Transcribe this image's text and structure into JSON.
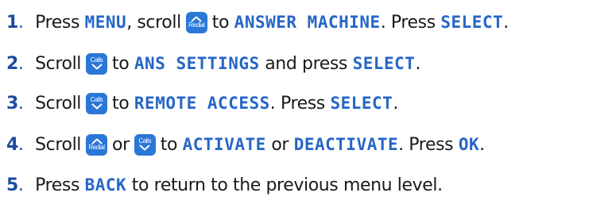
{
  "steps": [
    {
      "number": "1",
      "period": ".",
      "t1": " Press ",
      "lcd1": "MENU",
      "t2": ", scroll",
      "key1": {
        "label": "Redial",
        "icon": "chevron-up-icon"
      },
      "t3": "to ",
      "lcd2": "ANSWER MACHINE",
      "t4": ". Press ",
      "lcd3": "SELECT",
      "t5": "."
    },
    {
      "number": "2",
      "period": ".",
      "t1": " Scroll",
      "key1": {
        "label": "Calls",
        "icon": "chevron-down-icon"
      },
      "t2": "to ",
      "lcd1": "ANS SETTINGS",
      "t3": " and press ",
      "lcd2": "SELECT",
      "t4": "."
    },
    {
      "number": "3",
      "period": ".",
      "t1": " Scroll",
      "key1": {
        "label": "Calls",
        "icon": "chevron-down-icon"
      },
      "t2": "to ",
      "lcd1": "REMOTE ACCESS",
      "t3": ". Press ",
      "lcd2": "SELECT",
      "t4": "."
    },
    {
      "number": "4",
      "period": ".",
      "t1": " Scroll",
      "key1": {
        "label": "Redial",
        "icon": "chevron-up-icon"
      },
      "t2": "or",
      "key2": {
        "label": "Calls",
        "icon": "chevron-down-icon"
      },
      "t3": "to ",
      "lcd1": "ACTIVATE",
      "t4": " or ",
      "lcd2": "DEACTIVATE",
      "t5": ". Press ",
      "lcd3": "OK",
      "t6": "."
    },
    {
      "number": "5",
      "period": ".",
      "t1": " Press ",
      "lcd1": "BACK",
      "t2": " to return to the previous menu level."
    }
  ],
  "colors": {
    "step_number": "#1e4ba1",
    "lcd_text": "#2566c7",
    "key_background": "#2a77d6",
    "body_text": "#1a1a1a"
  }
}
